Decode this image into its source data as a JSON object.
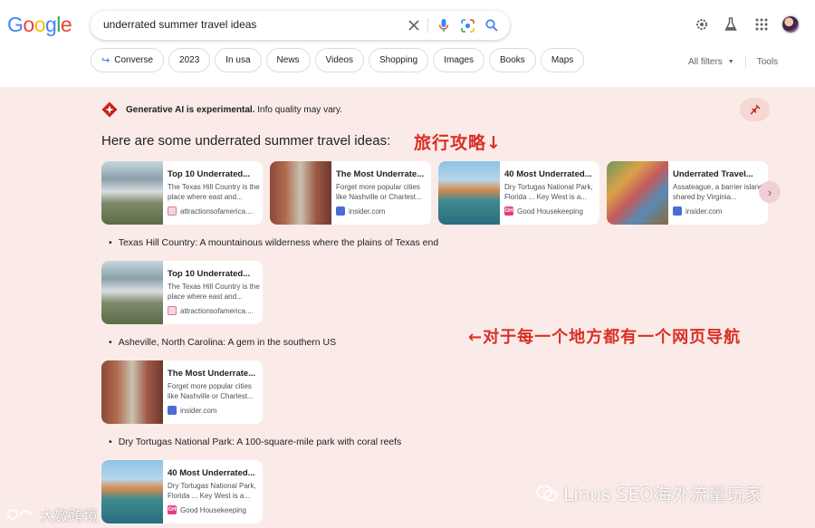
{
  "logo": {
    "letters": [
      {
        "ch": "G",
        "color": "#4285f4"
      },
      {
        "ch": "o",
        "color": "#ea4335"
      },
      {
        "ch": "o",
        "color": "#fbbc05"
      },
      {
        "ch": "g",
        "color": "#4285f4"
      },
      {
        "ch": "l",
        "color": "#34a853"
      },
      {
        "ch": "e",
        "color": "#ea4335"
      }
    ]
  },
  "search": {
    "query": "underrated summer travel ideas"
  },
  "chips": [
    {
      "label": "Converse",
      "icon": "return-arrow-icon"
    },
    {
      "label": "2023"
    },
    {
      "label": "In usa"
    },
    {
      "label": "News"
    },
    {
      "label": "Videos"
    },
    {
      "label": "Shopping"
    },
    {
      "label": "Images"
    },
    {
      "label": "Books"
    },
    {
      "label": "Maps"
    }
  ],
  "filters": {
    "all_filters": "All filters",
    "tools": "Tools"
  },
  "ai": {
    "notice_bold": "Generative AI is experimental.",
    "notice_rest": "Info quality may vary.",
    "heading": "Here are some underrated summer travel ideas:",
    "annotation_top": "旅行攻略↓",
    "annotation_mid": "←对于每一个地方都有一个网页导航"
  },
  "cards": [
    {
      "title": "Top 10 Underrated...",
      "snippet": "The Texas Hill Country is the place where east and...",
      "source": "attractionsofamerica....",
      "fav": "pink"
    },
    {
      "title": "The Most Underrate...",
      "snippet": "Forget more popular cities like Nashville or Charlest...",
      "source": "insider.com",
      "fav": "blue"
    },
    {
      "title": "40 Most Underrated...",
      "snippet": "Dry Tortugas National Park, Florida ... Key West is a...",
      "source": "Good Housekeeping",
      "fav": "gh"
    },
    {
      "title": "Underrated Travel...",
      "snippet": "Assateague, a barrier island shared by Virginia...",
      "source": "insider.com",
      "fav": "blue"
    }
  ],
  "bullets": [
    "Texas Hill Country: A mountainous wilderness where the plains of Texas end",
    "Asheville, North Carolina: A gem in the southern US",
    "Dry Tortugas National Park: A 100-square-mile park with coral reefs"
  ],
  "watermarks": {
    "right": "Linus SEO海外流量玩家",
    "left": "大數跨境"
  },
  "colors": {
    "accent_red": "#d93025",
    "panel_bg": "#fbebe8",
    "link_blue": "#1a73e8"
  }
}
